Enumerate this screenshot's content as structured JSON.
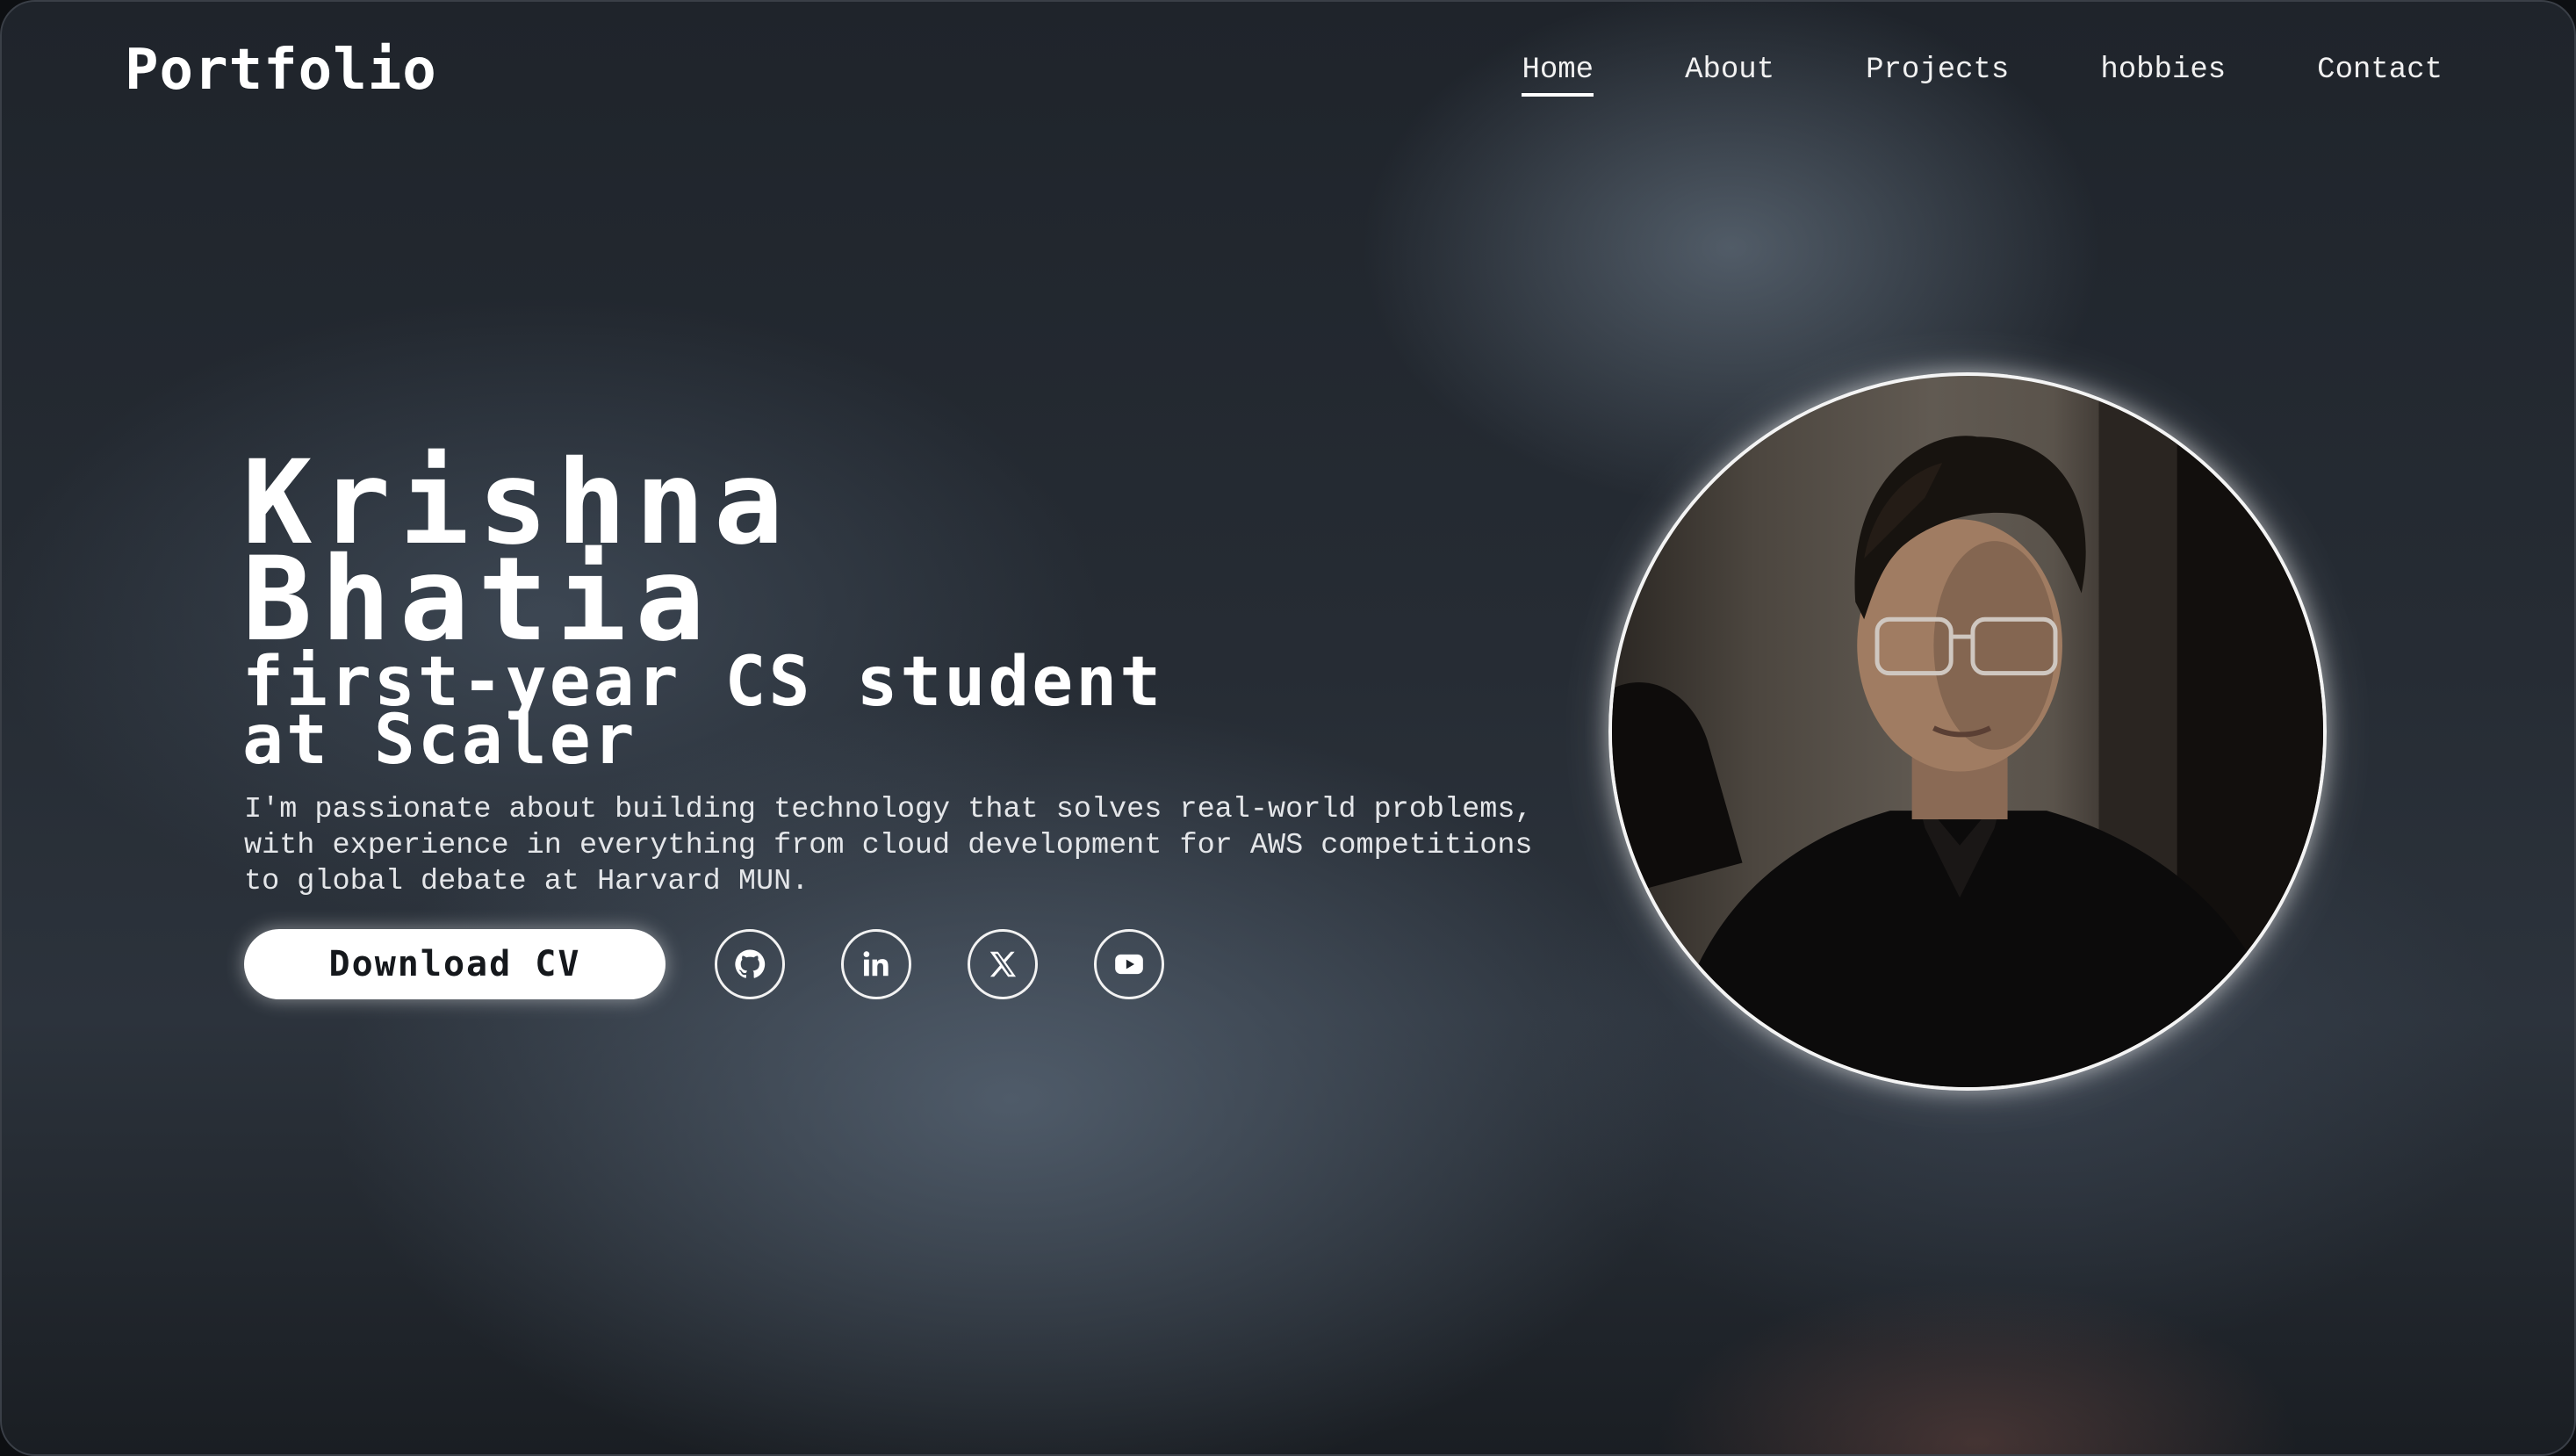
{
  "header": {
    "logo": "Portfolio",
    "nav": [
      {
        "label": "Home",
        "active": true
      },
      {
        "label": "About",
        "active": false
      },
      {
        "label": "Projects",
        "active": false
      },
      {
        "label": "hobbies",
        "active": false
      },
      {
        "label": "Contact",
        "active": false
      }
    ]
  },
  "hero": {
    "name_line1": "Krishna",
    "name_line2": "Bhatia",
    "tagline_line1": "first-year CS student",
    "tagline_line2": "at Scaler",
    "description": "I'm passionate about building technology that solves real-world problems, with experience in everything from cloud development for AWS competitions to global debate at Harvard MUN.",
    "cv_button": "Download CV"
  },
  "socials": [
    {
      "name": "github-icon"
    },
    {
      "name": "linkedin-icon"
    },
    {
      "name": "x-icon"
    },
    {
      "name": "youtube-icon"
    }
  ],
  "colors": {
    "text": "#ffffff",
    "button_bg": "#ffffff",
    "button_text": "#15181c"
  }
}
